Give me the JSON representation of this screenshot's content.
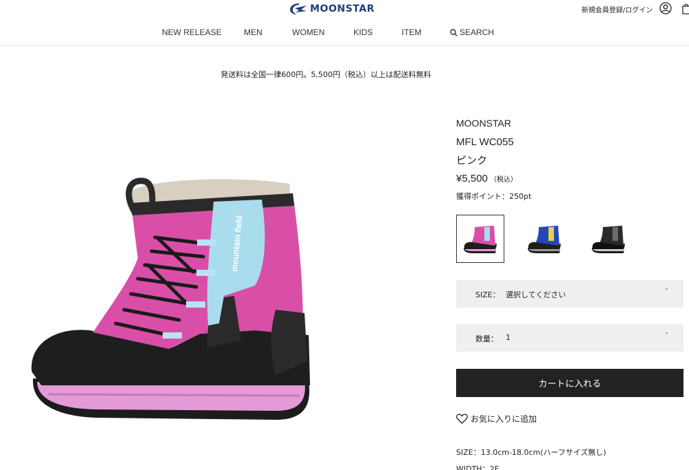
{
  "header": {
    "logo_text": "MOONSTAR",
    "account_link": "新規会員登録/ログイン",
    "icons": {
      "user": "user-icon",
      "bag": "shopping-bag-icon"
    }
  },
  "nav": {
    "items": [
      {
        "label": "NEW RELEASE"
      },
      {
        "label": "MEN"
      },
      {
        "label": "WOMEN"
      },
      {
        "label": "KIDS"
      },
      {
        "label": "ITEM"
      },
      {
        "label": "SEARCH",
        "icon": "search-icon"
      }
    ]
  },
  "notice": {
    "shipping": "発送料は全国一律600円。5,500円（税込）以上は配送料無料"
  },
  "product": {
    "brand": "MOONSTAR",
    "model": "MFL WC055",
    "color": "ピンク",
    "price": "¥5,500",
    "tax": "（税込）",
    "points": "獲得ポイント：250pt",
    "variants": [
      {
        "color": "pink",
        "selected": true
      },
      {
        "color": "blue",
        "selected": false
      },
      {
        "color": "black",
        "selected": false
      }
    ],
    "size_select": {
      "label": "SIZE：",
      "value": "選択してください"
    },
    "qty_select": {
      "label": "数量：",
      "value": "1"
    },
    "cart_button": "カートに入れる",
    "favorite": "お気に入りに追加",
    "spec_size": "SIZE：13.0cm-18.0cm(ハーフサイズ無し)",
    "spec_width": "WIDTH：2E"
  },
  "colors": {
    "accent": "#222222",
    "select_bg": "#efefef",
    "logo": "#1d3f7a",
    "boot_pink": "#d94fa8",
    "boot_light_blue": "#a9dced"
  }
}
